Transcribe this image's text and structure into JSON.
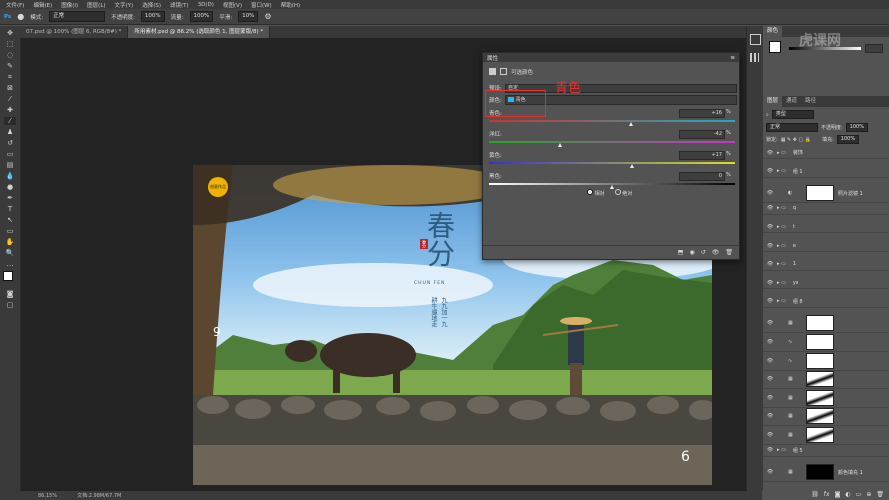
{
  "menu": [
    "文件(F)",
    "编辑(E)",
    "图像(I)",
    "图层(L)",
    "文字(Y)",
    "选择(S)",
    "滤镜(T)",
    "3D(D)",
    "视图(V)",
    "窗口(W)",
    "帮助(H)"
  ],
  "options": {
    "mode_label": "模式:",
    "mode_value": "正常",
    "opacity_label": "不透明度:",
    "opacity_value": "100%",
    "flow_label": "流量:",
    "flow_value": "100%",
    "smooth_label": "平滑:",
    "smooth_value": "10%"
  },
  "tabs": [
    {
      "label": "07.psd @ 100% (图层 6, RGB/8#) *",
      "active": false
    },
    {
      "label": "所用素材.psd @ 86.2% (选取颜色 1, 图层蒙版/8) *",
      "active": true
    }
  ],
  "status": {
    "zoom": "86.15%",
    "doc": "文档:2.98M/67.7M"
  },
  "properties": {
    "title": "属性",
    "subtitle": "可选颜色",
    "preset_label": "预设:",
    "preset_value": "自定",
    "colors_label": "颜色:",
    "colors_value": "青色",
    "annotation": "青色",
    "sliders": [
      {
        "label": "青色:",
        "value": "+16",
        "pct": 16
      },
      {
        "label": "洋红:",
        "value": "-42",
        "pct": -42
      },
      {
        "label": "黄色:",
        "value": "+17",
        "pct": 17
      },
      {
        "label": "黑色:",
        "value": "0",
        "pct": 0
      }
    ],
    "unit": "%",
    "relative_label": "相对",
    "absolute_label": "绝对"
  },
  "photo": {
    "badge": "创意作品",
    "title": "春分",
    "stamp": "春分",
    "pinyin": "CHUN FEN",
    "poem": [
      "耕牛遍地走",
      "九九加一九"
    ],
    "num_left": "9",
    "num_right": "6"
  },
  "right_panel": {
    "color_tabs": [
      "颜色"
    ],
    "layer_tabs": [
      "图层",
      "通道",
      "路径"
    ],
    "kind_label": "类型",
    "blend_value": "正常",
    "opacity_label": "不透明度:",
    "opacity_value": "100%",
    "lock_label": "锁定:",
    "fill_label": "填充:",
    "fill_value": "100%",
    "layers": [
      {
        "name": "装饰",
        "type": "group"
      },
      {
        "name": "组 1",
        "type": "group"
      },
      {
        "name": "照片滤镜 1",
        "type": "adjust"
      },
      {
        "name": "q",
        "type": "group"
      },
      {
        "name": "t",
        "type": "group"
      },
      {
        "name": "e",
        "type": "group"
      },
      {
        "name": "1",
        "type": "group"
      },
      {
        "name": "ys",
        "type": "group"
      },
      {
        "name": "组 8",
        "type": "group"
      },
      {
        "name": "",
        "type": "sel"
      },
      {
        "name": "",
        "type": "curve"
      },
      {
        "name": "",
        "type": "curve"
      },
      {
        "name": "",
        "type": "mask"
      },
      {
        "name": "",
        "type": "mask"
      },
      {
        "name": "",
        "type": "mask"
      },
      {
        "name": "",
        "type": "mask"
      },
      {
        "name": "组 5",
        "type": "group"
      },
      {
        "name": "颜色填充 1",
        "type": "fill"
      }
    ]
  },
  "watermark": "虎课网"
}
